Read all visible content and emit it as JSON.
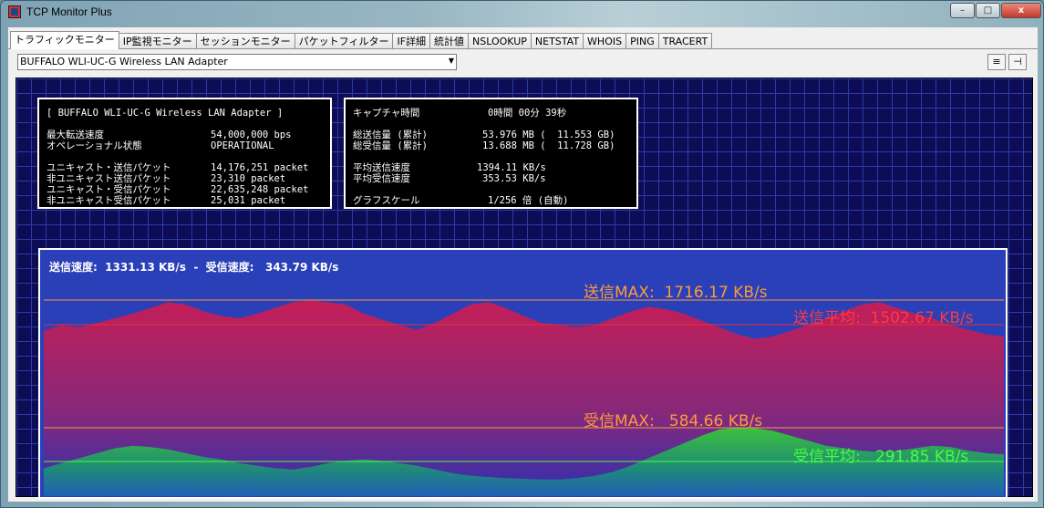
{
  "window": {
    "title": "TCP Monitor Plus",
    "min": "–",
    "max": "□",
    "close": "x"
  },
  "tabs": [
    {
      "label": "トラフィックモニター",
      "active": true
    },
    {
      "label": "IP監視モニター"
    },
    {
      "label": "セッションモニター"
    },
    {
      "label": "パケットフィルター"
    },
    {
      "label": "IF詳細"
    },
    {
      "label": "統計値"
    },
    {
      "label": "NSLOOKUP"
    },
    {
      "label": "NETSTAT"
    },
    {
      "label": "WHOIS"
    },
    {
      "label": "PING"
    },
    {
      "label": "TRACERT"
    }
  ],
  "adapter_select": {
    "value": "BUFFALO WLI-UC-G Wireless LAN Adapter",
    "arrow": "▼"
  },
  "toolbar": {
    "list_icon": "≡",
    "pin_icon": "⊣"
  },
  "left_panel": {
    "header": "[ BUFFALO WLI-UC-G Wireless LAN Adapter ]",
    "rows": [
      {
        "label": "最大転送速度",
        "value": "54,000,000 bps"
      },
      {
        "label": "オペレーショナル状態",
        "value": "OPERATIONAL"
      },
      {
        "label": "ユニキャスト・送信パケット",
        "value": "14,176,251 packet"
      },
      {
        "label": "非ユニキャスト送信パケット",
        "value": "23,310 packet"
      },
      {
        "label": "ユニキャスト・受信パケット",
        "value": "22,635,248 packet"
      },
      {
        "label": "非ユニキャスト受信パケット",
        "value": "25,031 packet"
      }
    ]
  },
  "right_panel": {
    "rows": [
      {
        "label": "キャプチャ時間",
        "value": "0時間 00分 39秒"
      },
      {
        "label": "総送信量 (累計)",
        "value": "53.976 MB (  11.553 GB)"
      },
      {
        "label": "総受信量 (累計)",
        "value": "13.688 MB (  11.728 GB)"
      },
      {
        "label": "平均送信速度",
        "value": "1394.11 KB/s"
      },
      {
        "label": "平均受信速度",
        "value": "353.53 KB/s"
      },
      {
        "label": "グラフスケール",
        "value": "1/256 倍 (自動)"
      }
    ]
  },
  "graph": {
    "rate_text": "送信速度:  1331.13 KB/s  -  受信速度:   343.79 KB/s",
    "send_max": "送信MAX:  1716.17 KB/s",
    "send_avg": "送信平均:  1502.67 KB/s",
    "recv_max": "受信MAX:   584.66 KB/s",
    "recv_avg": "受信平均:   291.85 KB/s",
    "colors": {
      "send": "#c0205a",
      "recv": "#34b030",
      "max_line": "#ff9a3a",
      "avg_send": "#e83030",
      "avg_recv": "#44ff44",
      "bg": "#2a40b8"
    }
  },
  "chart_data": {
    "type": "area",
    "series": [
      {
        "name": "送信",
        "values": [
          1450,
          1500,
          1480,
          1520,
          1560,
          1600,
          1650,
          1700,
          1680,
          1620,
          1580,
          1560,
          1600,
          1650,
          1700,
          1716,
          1700,
          1680,
          1600,
          1550,
          1500,
          1460,
          1520,
          1600,
          1680,
          1700,
          1650,
          1580,
          1520,
          1500,
          1480,
          1500,
          1560,
          1620,
          1660,
          1640,
          1600,
          1540,
          1480,
          1420,
          1380,
          1400,
          1450,
          1500,
          1560,
          1620,
          1680,
          1700,
          1650,
          1600,
          1560,
          1500,
          1460,
          1420,
          1400
        ]
      },
      {
        "name": "受信",
        "values": [
          260,
          300,
          340,
          380,
          420,
          440,
          430,
          410,
          380,
          350,
          330,
          300,
          280,
          260,
          250,
          270,
          300,
          320,
          330,
          320,
          300,
          280,
          250,
          220,
          200,
          190,
          180,
          175,
          170,
          170,
          180,
          200,
          230,
          280,
          340,
          400,
          460,
          520,
          570,
          584,
          580,
          560,
          520,
          480,
          440,
          420,
          400,
          390,
          400,
          420,
          440,
          430,
          400,
          380,
          370
        ]
      }
    ]
  }
}
